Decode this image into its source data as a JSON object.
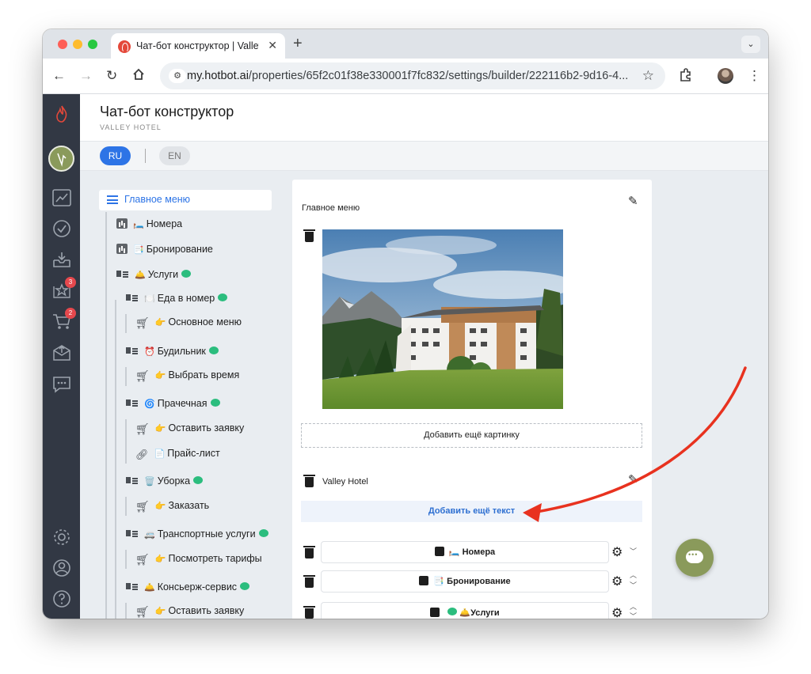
{
  "browser": {
    "tab_title": "Чат-бот конструктор | Valley Hotel",
    "url_host": "my.hotbot.ai",
    "url_path": "/properties/65f2c01f38e330001f7fc832/settings/builder/222116b2-9d16-4..."
  },
  "app_nav": {
    "badges": {
      "reviews": "3",
      "orders": "2"
    }
  },
  "header": {
    "title": "Чат-бот конструктор",
    "subtitle": "VALLEY HOTEL"
  },
  "languages": {
    "active": "RU",
    "inactive": "EN"
  },
  "tree": {
    "root": "Главное меню",
    "items": [
      {
        "emoji": "🛏️",
        "label": "Номера"
      },
      {
        "emoji": "📑",
        "label": "Бронирование"
      },
      {
        "emoji": "🛎️",
        "label": "Услуги"
      },
      {
        "emoji": "🍽️",
        "label": "Еда в номер"
      },
      {
        "emoji": "👉",
        "label": "Основное меню"
      },
      {
        "emoji": "⏰",
        "label": "Будильник"
      },
      {
        "emoji": "👉",
        "label": "Выбрать время"
      },
      {
        "emoji": "🌀",
        "label": "Прачечная"
      },
      {
        "emoji": "👉",
        "label": "Оставить заявку"
      },
      {
        "emoji": "📄",
        "label": "Прайс-лист"
      },
      {
        "emoji": "🗑️",
        "label": "Уборка"
      },
      {
        "emoji": "👉",
        "label": "Заказать"
      },
      {
        "emoji": "🚐",
        "label": "Транспортные услуги"
      },
      {
        "emoji": "👉",
        "label": "Посмотреть тарифы"
      },
      {
        "emoji": "🛎️",
        "label": "Консьерж-сервис"
      },
      {
        "emoji": "👉",
        "label": "Оставить заявку"
      }
    ]
  },
  "panel": {
    "title": "Главное меню",
    "add_image": "Добавить ещё картинку",
    "text_block": "Valley Hotel",
    "add_text": "Добавить ещё текст",
    "buttons": [
      {
        "emoji": "🛏️",
        "label": "Номера"
      },
      {
        "emoji": "📑",
        "label": "Бронирование"
      },
      {
        "emoji": "🛎️",
        "label": "Услуги"
      }
    ]
  },
  "colors": {
    "accent": "#2d74e6",
    "sidebar": "#323844",
    "annotation_arrow": "#e8321f",
    "fab": "#8a9a5b"
  }
}
